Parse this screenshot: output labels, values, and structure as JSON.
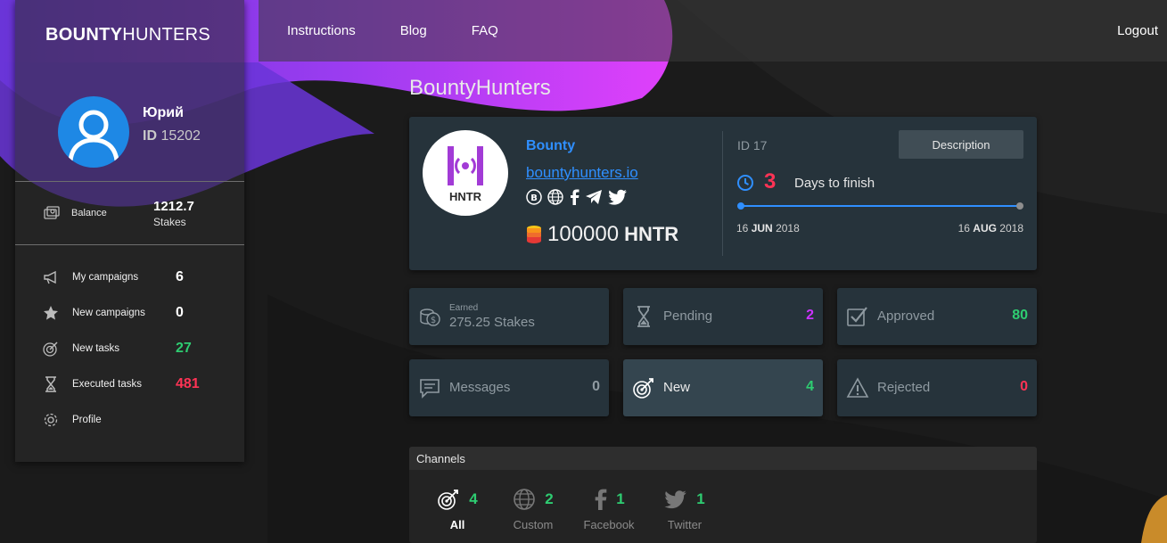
{
  "brand": {
    "bold": "BOUNTY",
    "light": "HUNTERS"
  },
  "nav": {
    "items": [
      "Instructions",
      "Blog",
      "FAQ"
    ],
    "logout": "Logout"
  },
  "user": {
    "name": "Юрий",
    "id_label": "ID",
    "id": "15202"
  },
  "balance": {
    "label": "Balance",
    "value": "1212.7",
    "unit": "Stakes"
  },
  "sidebar": {
    "items": [
      {
        "label": "My campaigns",
        "count": "6",
        "icon": "megaphone-icon",
        "color": "#ffffff"
      },
      {
        "label": "New campaigns",
        "count": "0",
        "icon": "star-icon",
        "color": "#ffffff"
      },
      {
        "label": "New tasks",
        "count": "27",
        "icon": "target-icon",
        "color": "#2ecc71"
      },
      {
        "label": "Executed tasks",
        "count": "481",
        "icon": "hourglass-icon",
        "color": "#ff3355"
      },
      {
        "label": "Profile",
        "count": "",
        "icon": "gear-icon",
        "color": "#ffffff"
      }
    ]
  },
  "page_title": "BountyHunters",
  "campaign": {
    "logo_ticker": "HNTR",
    "name": "Bounty",
    "link": "bountyhunters.io",
    "socials": [
      "bitcoin-icon",
      "globe-icon",
      "facebook-icon",
      "telegram-icon",
      "twitter-icon"
    ],
    "amount": "100000",
    "token": "HNTR",
    "id_label": "ID 17",
    "description_button": "Description",
    "days_left": "3",
    "days_label": "Days to finish",
    "start": {
      "day": "16",
      "month": "JUN",
      "year": "2018"
    },
    "end": {
      "day": "16",
      "month": "AUG",
      "year": "2018"
    }
  },
  "stats": {
    "earned": {
      "small": "Earned",
      "value": "275.25 Stakes"
    },
    "pending": {
      "label": "Pending",
      "count": "2"
    },
    "approved": {
      "label": "Approved",
      "count": "80"
    },
    "messages": {
      "label": "Messages",
      "count": "0"
    },
    "new": {
      "label": "New",
      "count": "4"
    },
    "rejected": {
      "label": "Rejected",
      "count": "0"
    }
  },
  "channels": {
    "title": "Channels",
    "items": [
      {
        "label": "All",
        "count": "4",
        "icon": "target-icon"
      },
      {
        "label": "Custom",
        "count": "2",
        "icon": "globe-icon"
      },
      {
        "label": "Facebook",
        "count": "1",
        "icon": "facebook-icon"
      },
      {
        "label": "Twitter",
        "count": "1",
        "icon": "twitter-icon"
      }
    ]
  },
  "colors": {
    "accent_blue": "#2f8fff",
    "green": "#2ecc71",
    "red": "#ff3355",
    "purple": "#cc33ff",
    "card": "#26333b"
  }
}
